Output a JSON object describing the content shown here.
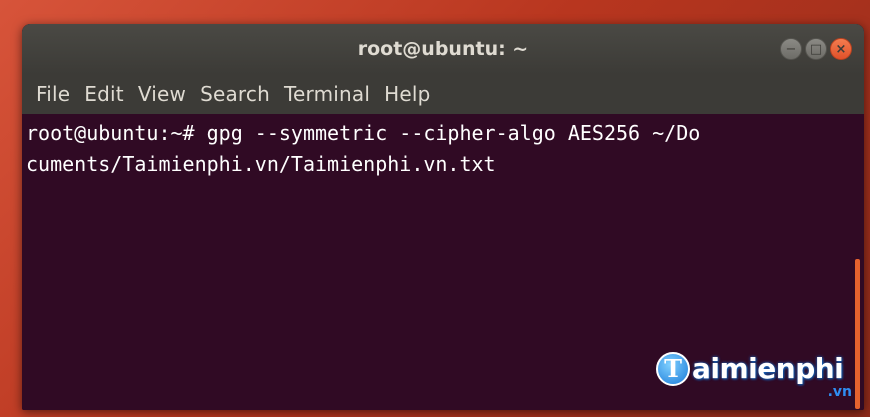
{
  "window": {
    "title": "root@ubuntu: ~",
    "controls": {
      "minimize": "−",
      "maximize": "□",
      "close": "×"
    }
  },
  "menu": {
    "items": [
      {
        "label": "File"
      },
      {
        "label": "Edit"
      },
      {
        "label": "View"
      },
      {
        "label": "Search"
      },
      {
        "label": "Terminal"
      },
      {
        "label": "Help"
      }
    ]
  },
  "terminal": {
    "lines": [
      "root@ubuntu:~# gpg --symmetric --cipher-algo AES256 ~/Do",
      "cuments/Taimienphi.vn/Taimienphi.vn.txt"
    ]
  },
  "watermark": {
    "logo_letter": "T",
    "text": "aimienphi",
    "sub": ".vn"
  },
  "colors": {
    "terminal_bg": "#300a24",
    "titlebar_bg": "#3c3b37",
    "accent": "#e6622e"
  }
}
